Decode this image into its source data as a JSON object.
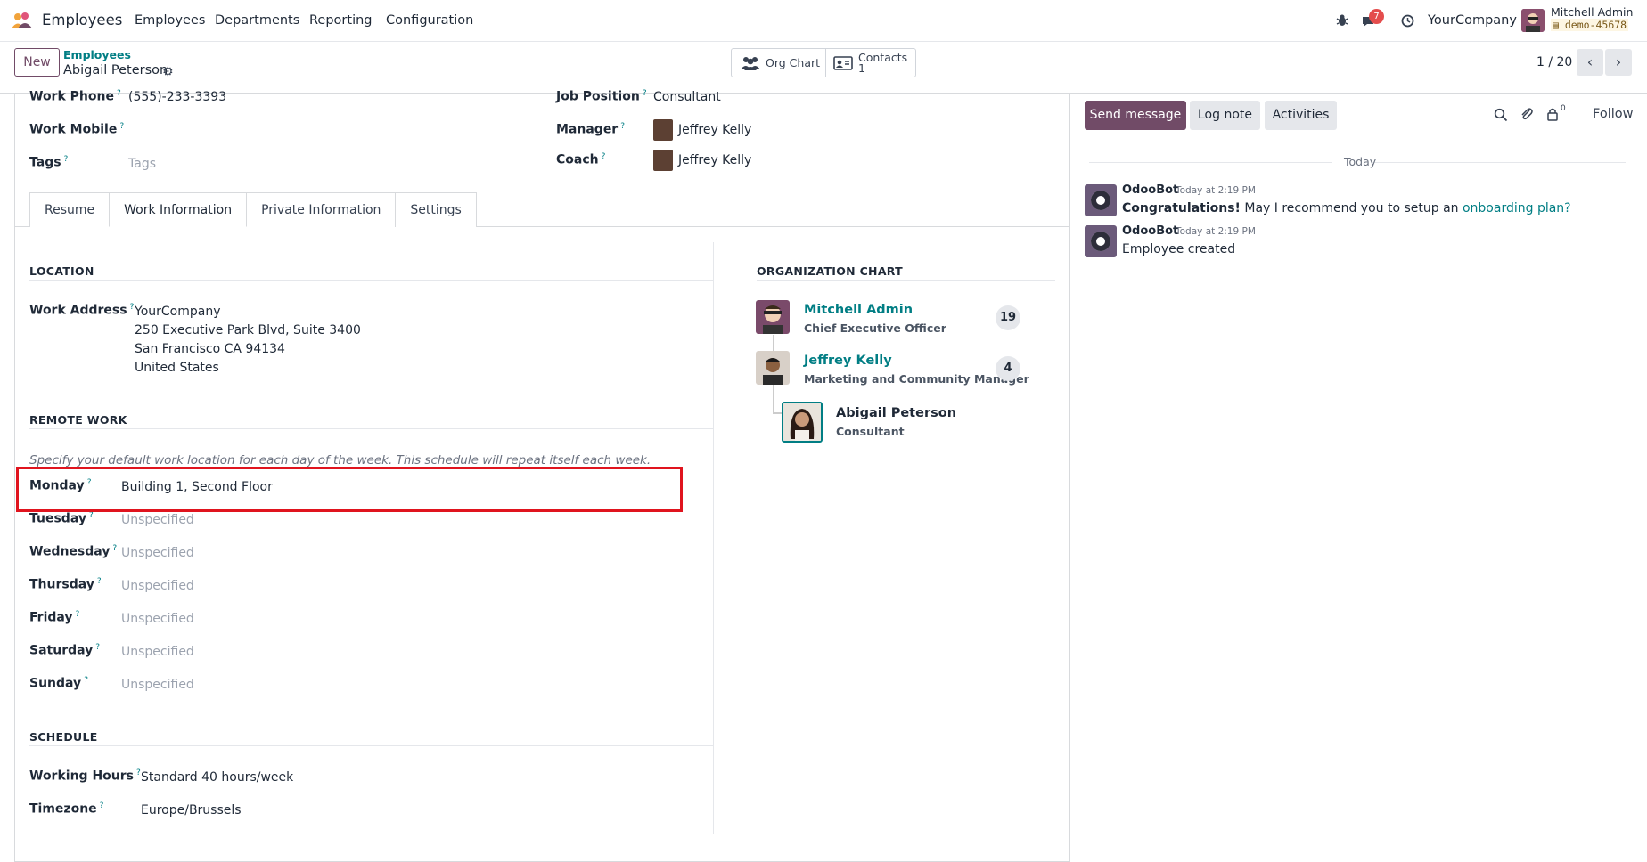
{
  "navbar": {
    "app_name": "Employees",
    "menu": [
      "Employees",
      "Departments",
      "Reporting",
      "Configuration"
    ],
    "message_count": "7",
    "company": "YourCompany",
    "user_name": "Mitchell Admin",
    "db_name": "demo-45678"
  },
  "control_panel": {
    "new_label": "New",
    "breadcrumb_parent": "Employees",
    "breadcrumb_current": "Abigail Peterson",
    "org_chart_label": "Org Chart",
    "contacts_label": "Contacts",
    "contacts_count": "1",
    "pager": "1 / 20"
  },
  "header_fields": {
    "work_phone_label": "Work Phone",
    "work_phone": "(555)-233-3393",
    "work_mobile_label": "Work Mobile",
    "tags_label": "Tags",
    "tags_placeholder": "Tags",
    "job_position_label": "Job Position",
    "job_position": "Consultant",
    "manager_label": "Manager",
    "manager": "Jeffrey Kelly",
    "coach_label": "Coach",
    "coach": "Jeffrey Kelly"
  },
  "tabs": [
    "Resume",
    "Work Information",
    "Private Information",
    "Settings"
  ],
  "location": {
    "title": "LOCATION",
    "work_address_label": "Work Address",
    "address_lines": [
      "YourCompany",
      "250 Executive Park Blvd, Suite 3400",
      "San Francisco CA 94134",
      "United States"
    ]
  },
  "remote_work": {
    "title": "REMOTE WORK",
    "hint": "Specify your default work location for each day of the week. This schedule will repeat itself each week.",
    "days": [
      {
        "day": "Monday",
        "value": "Building 1, Second Floor"
      },
      {
        "day": "Tuesday",
        "value": "Unspecified"
      },
      {
        "day": "Wednesday",
        "value": "Unspecified"
      },
      {
        "day": "Thursday",
        "value": "Unspecified"
      },
      {
        "day": "Friday",
        "value": "Unspecified"
      },
      {
        "day": "Saturday",
        "value": "Unspecified"
      },
      {
        "day": "Sunday",
        "value": "Unspecified"
      }
    ]
  },
  "schedule": {
    "title": "SCHEDULE",
    "working_hours_label": "Working Hours",
    "working_hours": "Standard 40 hours/week",
    "timezone_label": "Timezone",
    "timezone": "Europe/Brussels"
  },
  "org_chart": {
    "title": "ORGANIZATION CHART",
    "nodes": [
      {
        "name": "Mitchell Admin",
        "title": "Chief Executive Officer",
        "count": "19"
      },
      {
        "name": "Jeffrey Kelly",
        "title": "Marketing and Community Manager",
        "count": "4"
      },
      {
        "name": "Abigail Peterson",
        "title": "Consultant"
      }
    ]
  },
  "chatter": {
    "send_message": "Send message",
    "log_note": "Log note",
    "activities": "Activities",
    "followers_count": "0",
    "follow": "Follow",
    "date_separator": "Today",
    "messages": [
      {
        "author": "OdooBot",
        "time": "Today at 2:19 PM",
        "bold": "Congratulations!",
        "text": " May I recommend you to setup an ",
        "link": "onboarding plan?"
      },
      {
        "author": "OdooBot",
        "time": "Today at 2:19 PM",
        "text": "Employee created"
      }
    ]
  }
}
